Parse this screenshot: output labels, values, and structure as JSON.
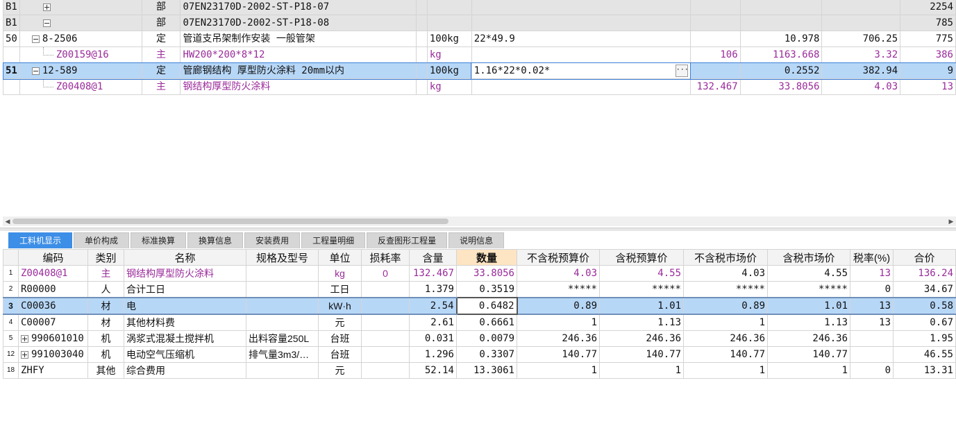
{
  "top_rows": [
    {
      "num": "B1",
      "tree": "plus",
      "code": "",
      "type": "部",
      "name": "07EN23170D-2002-ST-P18-07",
      "unit": "",
      "expr": "",
      "c8": "",
      "c9": "",
      "c10": "",
      "c11": "2254",
      "style": "grey"
    },
    {
      "num": "B1",
      "tree": "minus",
      "code": "",
      "type": "部",
      "name": "07EN23170D-2002-ST-P18-08",
      "unit": "",
      "expr": "",
      "c8": "",
      "c9": "",
      "c10": "",
      "c11": "785",
      "style": "grey"
    },
    {
      "num": "50",
      "tree": "minus",
      "code": "8-2506",
      "type": "定",
      "name": "管道支吊架制作安装 一般管架",
      "unit": "100kg",
      "expr": "22*49.9",
      "c8": "",
      "c9": "10.978",
      "c10": "706.25",
      "c11": "775",
      "style": ""
    },
    {
      "num": "",
      "tree": "child",
      "code": "Z00159@16",
      "type": "主",
      "name": "HW200*200*8*12",
      "unit": "kg",
      "expr": "",
      "c8": "106",
      "c9": "1163.668",
      "c10": "3.32",
      "c11": "386",
      "style": "purple"
    },
    {
      "num": "51",
      "tree": "minus",
      "code": "12-589",
      "type": "定",
      "name": "管廊钢结构 厚型防火涂料 20mm以内",
      "unit": "100kg",
      "expr": "1.16*22*0.02*",
      "c8": "",
      "c9": "0.2552",
      "c10": "382.94",
      "c11": "9",
      "style": "sel"
    },
    {
      "num": "",
      "tree": "child",
      "code": "Z00408@1",
      "type": "主",
      "name": "钢结构厚型防火涂料",
      "unit": "kg",
      "expr": "",
      "c8": "132.467",
      "c9": "33.8056",
      "c10": "4.03",
      "c11": "13",
      "style": "purple"
    }
  ],
  "tabs": [
    "工料机显示",
    "单价构成",
    "标准换算",
    "换算信息",
    "安装费用",
    "工程量明细",
    "反查图形工程量",
    "说明信息"
  ],
  "headers": [
    "编码",
    "类别",
    "名称",
    "规格及型号",
    "单位",
    "损耗率",
    "含量",
    "数量",
    "不含税预算价",
    "含税预算价",
    "不含税市场价",
    "含税市场价",
    "税率(%)",
    "合价"
  ],
  "rows": [
    {
      "rn": "1",
      "tree": "",
      "code": "Z00408@1",
      "type": "主",
      "name": "钢结构厚型防火涂料",
      "spec": "",
      "unit": "kg",
      "loss": "0",
      "content": "132.467",
      "qty": "33.8056",
      "p1": "4.03",
      "p2": "4.55",
      "p3": "4.03",
      "p4": "4.55",
      "tax": "13",
      "total": "136.24",
      "style": "purple"
    },
    {
      "rn": "2",
      "tree": "",
      "code": "R00000",
      "type": "人",
      "name": "合计工日",
      "spec": "",
      "unit": "工日",
      "loss": "",
      "content": "1.379",
      "qty": "0.3519",
      "p1": "*****",
      "p2": "*****",
      "p3": "*****",
      "p4": "*****",
      "tax": "0",
      "total": "34.67",
      "style": ""
    },
    {
      "rn": "3",
      "tree": "",
      "code": "C00036",
      "type": "材",
      "name": "电",
      "spec": "",
      "unit": "kW·h",
      "loss": "",
      "content": "2.54",
      "qty": "0.6482",
      "p1": "0.89",
      "p2": "1.01",
      "p3": "0.89",
      "p4": "1.01",
      "tax": "13",
      "total": "0.58",
      "style": "sel"
    },
    {
      "rn": "4",
      "tree": "",
      "code": "C00007",
      "type": "材",
      "name": "其他材料费",
      "spec": "",
      "unit": "元",
      "loss": "",
      "content": "2.61",
      "qty": "0.6661",
      "p1": "1",
      "p2": "1.13",
      "p3": "1",
      "p4": "1.13",
      "tax": "13",
      "total": "0.67",
      "style": ""
    },
    {
      "rn": "5",
      "tree": "plus",
      "code": "990601010",
      "type": "机",
      "name": "涡浆式混凝土搅拌机",
      "spec": "出料容量250L",
      "unit": "台班",
      "loss": "",
      "content": "0.031",
      "qty": "0.0079",
      "p1": "246.36",
      "p2": "246.36",
      "p3": "246.36",
      "p4": "246.36",
      "tax": "",
      "total": "1.95",
      "style": ""
    },
    {
      "rn": "12",
      "tree": "plus",
      "code": "991003040",
      "type": "机",
      "name": "电动空气压缩机",
      "spec": "排气量3m3/…",
      "unit": "台班",
      "loss": "",
      "content": "1.296",
      "qty": "0.3307",
      "p1": "140.77",
      "p2": "140.77",
      "p3": "140.77",
      "p4": "140.77",
      "tax": "",
      "total": "46.55",
      "style": ""
    },
    {
      "rn": "18",
      "tree": "",
      "code": "ZHFY",
      "type": "其他",
      "name": "综合费用",
      "spec": "",
      "unit": "元",
      "loss": "",
      "content": "52.14",
      "qty": "13.3061",
      "p1": "1",
      "p2": "1",
      "p3": "1",
      "p4": "1",
      "tax": "0",
      "total": "13.31",
      "style": ""
    }
  ]
}
